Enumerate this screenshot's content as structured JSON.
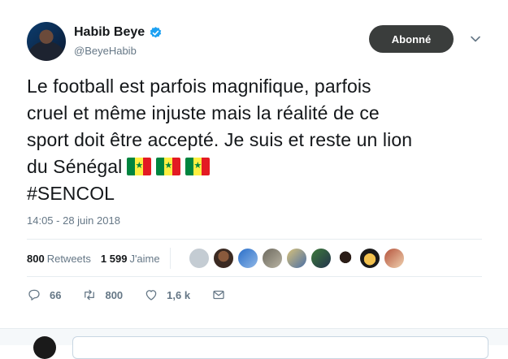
{
  "tweet": {
    "author": {
      "display_name": "Habib Beye",
      "handle": "@BeyeHabib",
      "verified": true,
      "verified_icon": "verified-badge-icon"
    },
    "follow_button_label": "Abonné",
    "text_lines": [
      "Le football est parfois magnifique, parfois",
      "cruel et même injuste mais la réalité de ce",
      "sport doit être accepté. Je suis et reste un lion",
      "du Sénégal",
      "#SENCOL"
    ],
    "emoji": [
      "flag-senegal",
      "flag-senegal",
      "flag-senegal"
    ],
    "timestamp": "14:05 - 28 juin 2018",
    "stats": {
      "retweets_count": "800",
      "retweets_label": "Retweets",
      "likes_count": "1 599",
      "likes_label": "J'aime"
    },
    "actions": {
      "reply_count": "66",
      "retweet_count": "800",
      "like_count": "1,6 k"
    }
  },
  "colors": {
    "accent": "#1da1f2",
    "follow_button": "#3a3d3c",
    "muted_text": "#657786",
    "flag_green": "#00853f",
    "flag_yellow": "#fdef42",
    "flag_red": "#e31b23"
  }
}
